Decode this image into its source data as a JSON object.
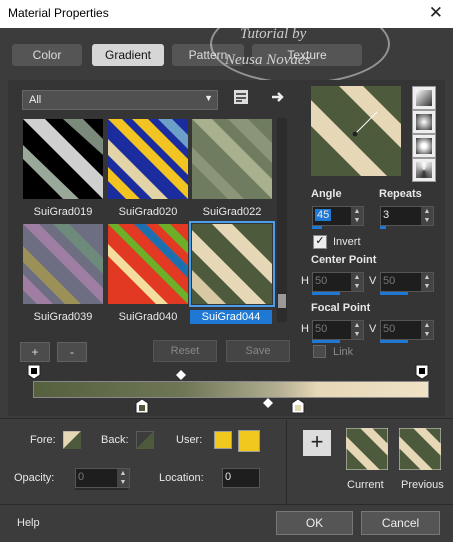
{
  "window": {
    "title": "Material Properties",
    "close_icon": "close-icon"
  },
  "watermark": {
    "line1": "Tutorial by",
    "line2": "Neusa Novaes"
  },
  "tabs": [
    {
      "label": "Color",
      "active": false
    },
    {
      "label": "Gradient",
      "active": true
    },
    {
      "label": "Pattern",
      "active": false
    },
    {
      "label": "Texture",
      "active": false
    }
  ],
  "library": {
    "selected": "All"
  },
  "gradients": [
    {
      "name": "SuiGrad019"
    },
    {
      "name": "SuiGrad020"
    },
    {
      "name": "SuiGrad022"
    },
    {
      "name": "SuiGrad039"
    },
    {
      "name": "SuiGrad040"
    },
    {
      "name": "SuiGrad044",
      "selected": true
    }
  ],
  "buttons": {
    "add": "+",
    "remove": "-",
    "reset": "Reset",
    "save": "Save"
  },
  "properties": {
    "angle_label": "Angle",
    "angle": "45",
    "repeats_label": "Repeats",
    "repeats": "3",
    "invert_label": "Invert",
    "invert_checked": true,
    "center_point_label": "Center Point",
    "h_label": "H",
    "v_label": "V",
    "center_h": "50",
    "center_v": "50",
    "focal_point_label": "Focal Point",
    "focal_h": "50",
    "focal_v": "50",
    "link_label": "Link"
  },
  "bottom": {
    "fore_label": "Fore:",
    "back_label": "Back:",
    "user_label": "User:",
    "opacity_label": "Opacity:",
    "opacity": "0",
    "location_label": "Location:",
    "location": "0",
    "current_label": "Current",
    "previous_label": "Previous",
    "user_color": "#f0c81e"
  },
  "footer": {
    "help": "Help",
    "ok": "OK",
    "cancel": "Cancel"
  },
  "colors": {
    "accent": "#1e78d4",
    "dark_green": "#4e5a3c",
    "cream": "#e6d7b7"
  }
}
